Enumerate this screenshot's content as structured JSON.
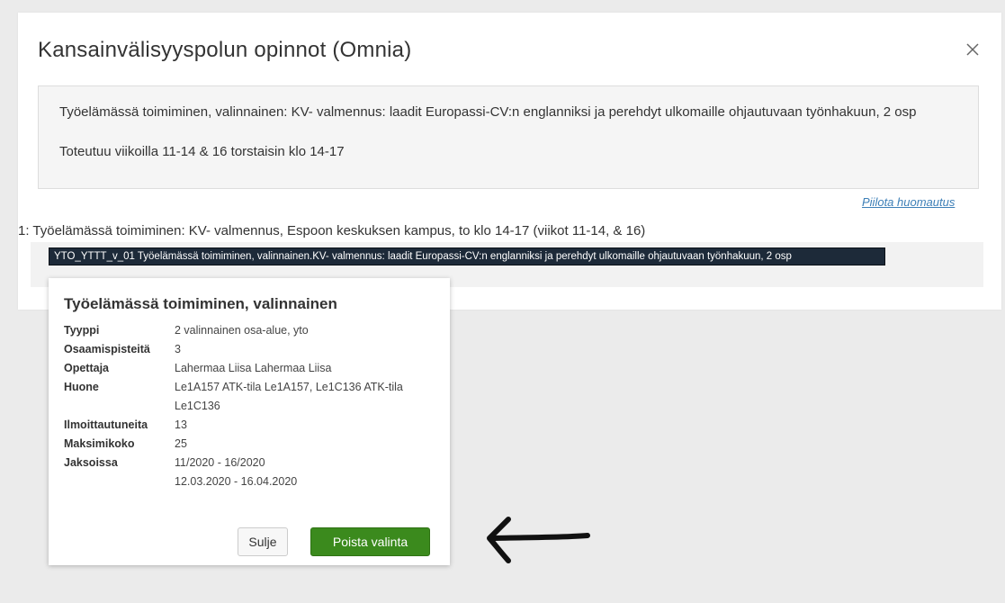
{
  "modal": {
    "title": "Kansainvälisyyspolun opinnot (Omnia)",
    "close_glyph": "×",
    "note": {
      "line1": "Työelämässä toimiminen, valinnainen: KV- valmennus: laadit Europassi-CV:n englanniksi ja perehdyt ulkomaille ohjautuvaan työnhakuun, 2 osp",
      "line2": "Toteutuu viikoilla 11-14 & 16 torstaisin klo 14-17"
    },
    "hide_link": "Piilota huomautus",
    "course_line": "1: Työelämässä toimiminen: KV- valmennus, Espoon keskuksen kampus, to klo 14-17 (viikot 11-14, & 16)",
    "selected_chip": "YTO_YTTT_v_01 Työelämässä toimiminen, valinnainen.KV- valmennus: laadit Europassi-CV:n englanniksi ja perehdyt ulkomaille ohjautuvaan työnhakuun, 2 osp"
  },
  "popover": {
    "title": "Työelämässä toimiminen, valinnainen",
    "rows": [
      {
        "key": "Tyyppi",
        "value": "2 valinnainen osa-alue, yto"
      },
      {
        "key": "Osaamispisteitä",
        "value": "3"
      },
      {
        "key": "Opettaja",
        "value": "Lahermaa Liisa Lahermaa Liisa"
      },
      {
        "key": "Huone",
        "value": "Le1A157 ATK-tila Le1A157, Le1C136 ATK-tila Le1C136"
      },
      {
        "key": "Ilmoittautuneita",
        "value": "13"
      },
      {
        "key": "Maksimikoko",
        "value": "25"
      },
      {
        "key": "Jaksoissa",
        "value": "11/2020 - 16/2020"
      },
      {
        "key": "",
        "value": "12.03.2020 - 16.04.2020"
      }
    ],
    "close_label": "Sulje",
    "remove_label": "Poista valinta"
  },
  "colors": {
    "accent_green": "#3b8a1d",
    "chip_dark": "#1d2a39",
    "link_blue": "#3d7fb7"
  },
  "icons": {
    "close": "close-icon",
    "annotation": "arrow-left-icon"
  }
}
